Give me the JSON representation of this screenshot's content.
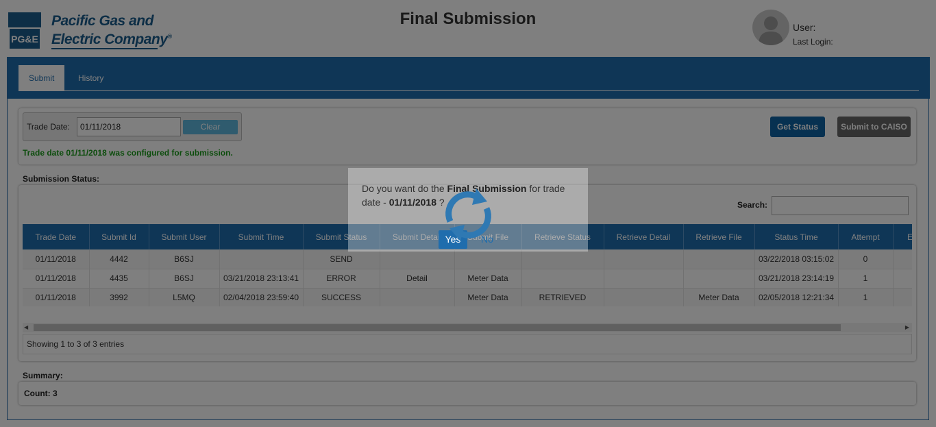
{
  "header": {
    "logo_mark_text": "PG&E",
    "company_line1": "Pacific Gas and",
    "company_line2": "Electric Company",
    "registered_mark": "®",
    "page_title": "Final Submission",
    "user_label": "User:",
    "last_login_label": "Last Login:"
  },
  "tabs": [
    {
      "label": "Submit",
      "active": true
    },
    {
      "label": "History",
      "active": false
    }
  ],
  "trade": {
    "label": "Trade Date:",
    "value": "01/11/2018",
    "clear_label": "Clear",
    "get_status_label": "Get Status",
    "submit_label": "Submit to CAISO",
    "message": "Trade date 01/11/2018 was configured for submission."
  },
  "submission_status": {
    "label": "Submission Status:",
    "search_label": "Search:",
    "search_value": "",
    "columns": [
      "Trade Date",
      "Submit Id",
      "Submit User",
      "Submit Time",
      "Submit Status",
      "Submit Detail",
      "Submit File",
      "Retrieve Status",
      "Retrieve Detail",
      "Retrieve File",
      "Status Time",
      "Attempt",
      "E"
    ],
    "rows": [
      {
        "trade_date": "01/11/2018",
        "submit_id": "4442",
        "submit_user": "B6SJ",
        "submit_time": "",
        "submit_status": "SEND",
        "submit_detail": "",
        "submit_file": "",
        "retrieve_status": "",
        "retrieve_detail": "",
        "retrieve_file": "",
        "status_time": "03/22/2018 03:15:02",
        "attempt": "0"
      },
      {
        "trade_date": "01/11/2018",
        "submit_id": "4435",
        "submit_user": "B6SJ",
        "submit_time": "03/21/2018 23:13:41",
        "submit_status": "ERROR",
        "submit_detail": "Detail",
        "submit_file": "Meter Data",
        "retrieve_status": "",
        "retrieve_detail": "",
        "retrieve_file": "",
        "status_time": "03/21/2018 23:14:19",
        "attempt": "1"
      },
      {
        "trade_date": "01/11/2018",
        "submit_id": "3992",
        "submit_user": "L5MQ",
        "submit_time": "02/04/2018 23:59:40",
        "submit_status": "SUCCESS",
        "submit_detail": "",
        "submit_file": "Meter Data",
        "retrieve_status": "RETRIEVED",
        "retrieve_detail": "",
        "retrieve_file": "Meter Data",
        "status_time": "02/05/2018 12:21:34",
        "attempt": "1"
      }
    ],
    "entries_info": "Showing 1 to 3 of 3 entries"
  },
  "summary": {
    "label": "Summary:",
    "count_text": "Count: 3"
  },
  "dialog": {
    "msg_prefix": "Do you want do the ",
    "msg_bold": "Final Submission",
    "msg_mid": " for trade date - ",
    "msg_date": "01/11/2018",
    "msg_suffix": " ?",
    "yes_label": "Yes",
    "no_label": "No"
  },
  "colors": {
    "brand_blue": "#1f6dad",
    "success_green": "#1a9a1a",
    "error_orange": "#e08a1f",
    "overlay": "rgba(0,0,0,0.5)"
  },
  "icons": {
    "loading": "refresh-spinner-icon",
    "avatar": "user-silhouette-icon",
    "scroll_left": "caret-left-icon",
    "scroll_right": "caret-right-icon"
  }
}
